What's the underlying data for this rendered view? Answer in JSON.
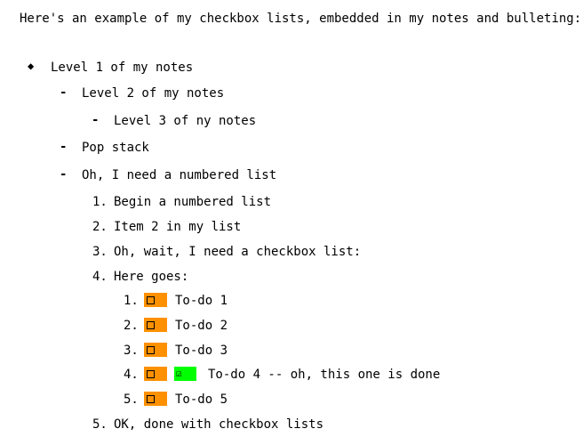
{
  "intro": "Here's an example of my checkbox lists, embedded in my notes and bulleting:",
  "level1": {
    "bullet": "◆",
    "text": "Level 1 of my notes"
  },
  "level2a": {
    "bullet": "-",
    "text": "Level 2 of my notes"
  },
  "level3": {
    "bullet": "-",
    "text": "Level 3 of ny notes"
  },
  "level2b": {
    "bullet": "-",
    "text": "Pop stack"
  },
  "level2c": {
    "bullet": "-",
    "text": "Oh, I need a numbered list"
  },
  "numbered": [
    {
      "num": "1.",
      "text": "Begin a numbered list"
    },
    {
      "num": "2.",
      "text": "Item 2 in my list"
    },
    {
      "num": "3.",
      "text": "Oh, wait, I need a checkbox list:"
    },
    {
      "num": "4.",
      "text": "Here goes:"
    },
    {
      "num": "5.",
      "text": "OK, done with checkbox lists"
    }
  ],
  "checklist": [
    {
      "num": "1.",
      "text": "To-do 1",
      "done": false
    },
    {
      "num": "2.",
      "text": "To-do 2",
      "done": false
    },
    {
      "num": "3.",
      "text": "To-do 3",
      "done": false
    },
    {
      "num": "4.",
      "text": "To-do 4 -- oh, this one is done",
      "done": true,
      "check_glyph": "☑"
    },
    {
      "num": "5.",
      "text": "To-do 5",
      "done": false
    }
  ],
  "colors": {
    "pending": "#ff9000",
    "done": "#00ff00"
  }
}
